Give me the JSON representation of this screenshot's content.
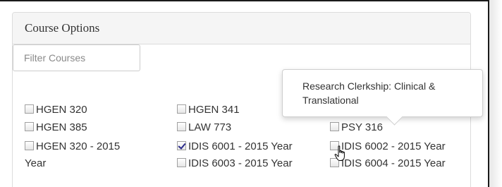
{
  "panel": {
    "title": "Course Options"
  },
  "filter": {
    "placeholder": "Filter Courses",
    "value": ""
  },
  "courses": {
    "c1": {
      "label": "HGEN 320",
      "checked": false
    },
    "c2": {
      "label": "HGEN 341",
      "checked": false
    },
    "c3": {
      "label": "HGEN 385",
      "checked": false
    },
    "c4": {
      "label": "LAW 773",
      "checked": false
    },
    "c5": {
      "label": "PSY 316",
      "checked": false
    },
    "c6": {
      "label_line1": "HGEN 320 - 2015",
      "label_line2": "Year",
      "checked": false
    },
    "c7": {
      "label": "IDIS 6001 - 2015 Year",
      "checked": true
    },
    "c8": {
      "label": "IDIS 6002 - 2015 Year",
      "checked": false
    },
    "c9": {
      "label": "IDIS 6003 - 2015 Year",
      "checked": false
    },
    "c10": {
      "label": "IDIS 6004 - 2015 Year",
      "checked": false
    }
  },
  "tooltip": {
    "text": "Research Clerkship: Clinical & Translational"
  },
  "colors": {
    "header_bg": "#f5f5f5",
    "border": "#dcdcdc",
    "text": "#333333",
    "check_mark": "#2a2a8a"
  },
  "icons": {
    "cursor": "hand-pointer-icon"
  }
}
